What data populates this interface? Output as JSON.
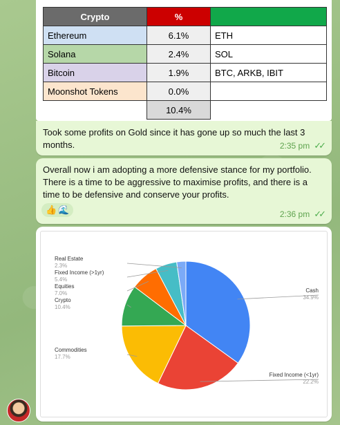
{
  "table": {
    "headers": [
      "Crypto",
      "%",
      ""
    ],
    "rows": [
      {
        "name": "Ethereum",
        "pct": "6.1%",
        "ticker": "ETH"
      },
      {
        "name": "Solana",
        "pct": "2.4%",
        "ticker": "SOL"
      },
      {
        "name": "Bitcoin",
        "pct": "1.9%",
        "ticker": "BTC, ARKB, IBIT"
      },
      {
        "name": "Moonshot Tokens",
        "pct": "0.0%",
        "ticker": ""
      }
    ],
    "total": "10.4%"
  },
  "messages": [
    {
      "text": "Took some profits on Gold since it has gone up so much the last 3 months.",
      "time": "2:35 pm"
    },
    {
      "text": "Overall now i am adopting a more defensive stance for my portfolio. There is a time to be aggressive to maximise profits, and there is a time to be defensive and conserve your profits.",
      "time": "2:36 pm",
      "reactions": [
        "thumbs-up-icon",
        "wave-icon"
      ]
    }
  ],
  "chart_data": {
    "type": "pie",
    "title": "",
    "slices": [
      {
        "label": "Cash",
        "value": 34.9,
        "display": "34.9%",
        "color": "#4285f4"
      },
      {
        "label": "Fixed Income (<1yr)",
        "value": 22.2,
        "display": "22.2%",
        "color": "#ea4335"
      },
      {
        "label": "Commodities",
        "value": 17.7,
        "display": "17.7%",
        "color": "#fbbc04"
      },
      {
        "label": "Crypto",
        "value": 10.4,
        "display": "10.4%",
        "color": "#34a853"
      },
      {
        "label": "Equities",
        "value": 7.0,
        "display": "7.0%",
        "color": "#ff6d01"
      },
      {
        "label": "Fixed Income (>1yr)",
        "value": 5.4,
        "display": "5.4%",
        "color": "#46bdc6"
      },
      {
        "label": "Real Estate",
        "value": 2.3,
        "display": "2.3%",
        "color": "#7baaf7"
      }
    ]
  }
}
